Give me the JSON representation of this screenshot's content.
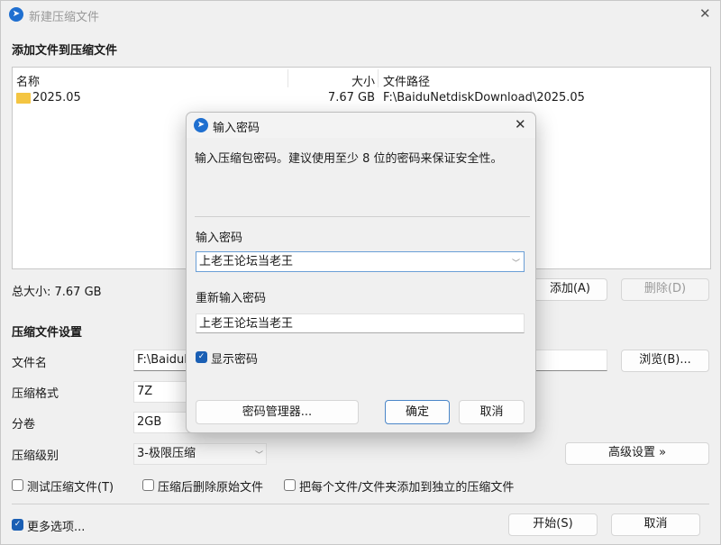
{
  "window": {
    "title": "新建压缩文件",
    "close": "✕"
  },
  "files": {
    "heading": "添加文件到压缩文件",
    "columns": [
      "名称",
      "大小",
      "文件路径"
    ],
    "rows": [
      {
        "name": "2025.05",
        "size": "7.67 GB",
        "path": "F:\\BaiduNetdiskDownload\\2025.05"
      }
    ],
    "total": "总大小: 7.67 GB",
    "add": "添加(A)",
    "delete": "删除(D)"
  },
  "settings": {
    "heading": "压缩文件设置",
    "filename_label": "文件名",
    "filename_value": "F:\\BaiduN",
    "browse": "浏览(B)...",
    "format_label": "压缩格式",
    "format_value": "7Z",
    "volume_label": "分卷",
    "volume_value": "2GB",
    "level_label": "压缩级别",
    "level_value": "3-极限压缩",
    "advanced": "高级设置 »",
    "test": "测试压缩文件(T)",
    "delete_after": "压缩后删除原始文件",
    "separate": "把每个文件/文件夹添加到独立的压缩文件",
    "more": "更多选项...",
    "start": "开始(S)",
    "cancel": "取消"
  },
  "dialog": {
    "title": "输入密码",
    "close": "✕",
    "hint": "输入压缩包密码。建议使用至少 8 位的密码来保证安全性。",
    "pw_label": "输入密码",
    "pw_value": "上老王论坛当老王",
    "pw2_label": "重新输入密码",
    "pw2_value": "上老王论坛当老王",
    "show": "显示密码",
    "manager": "密码管理器...",
    "ok": "确定",
    "cancel": "取消"
  }
}
